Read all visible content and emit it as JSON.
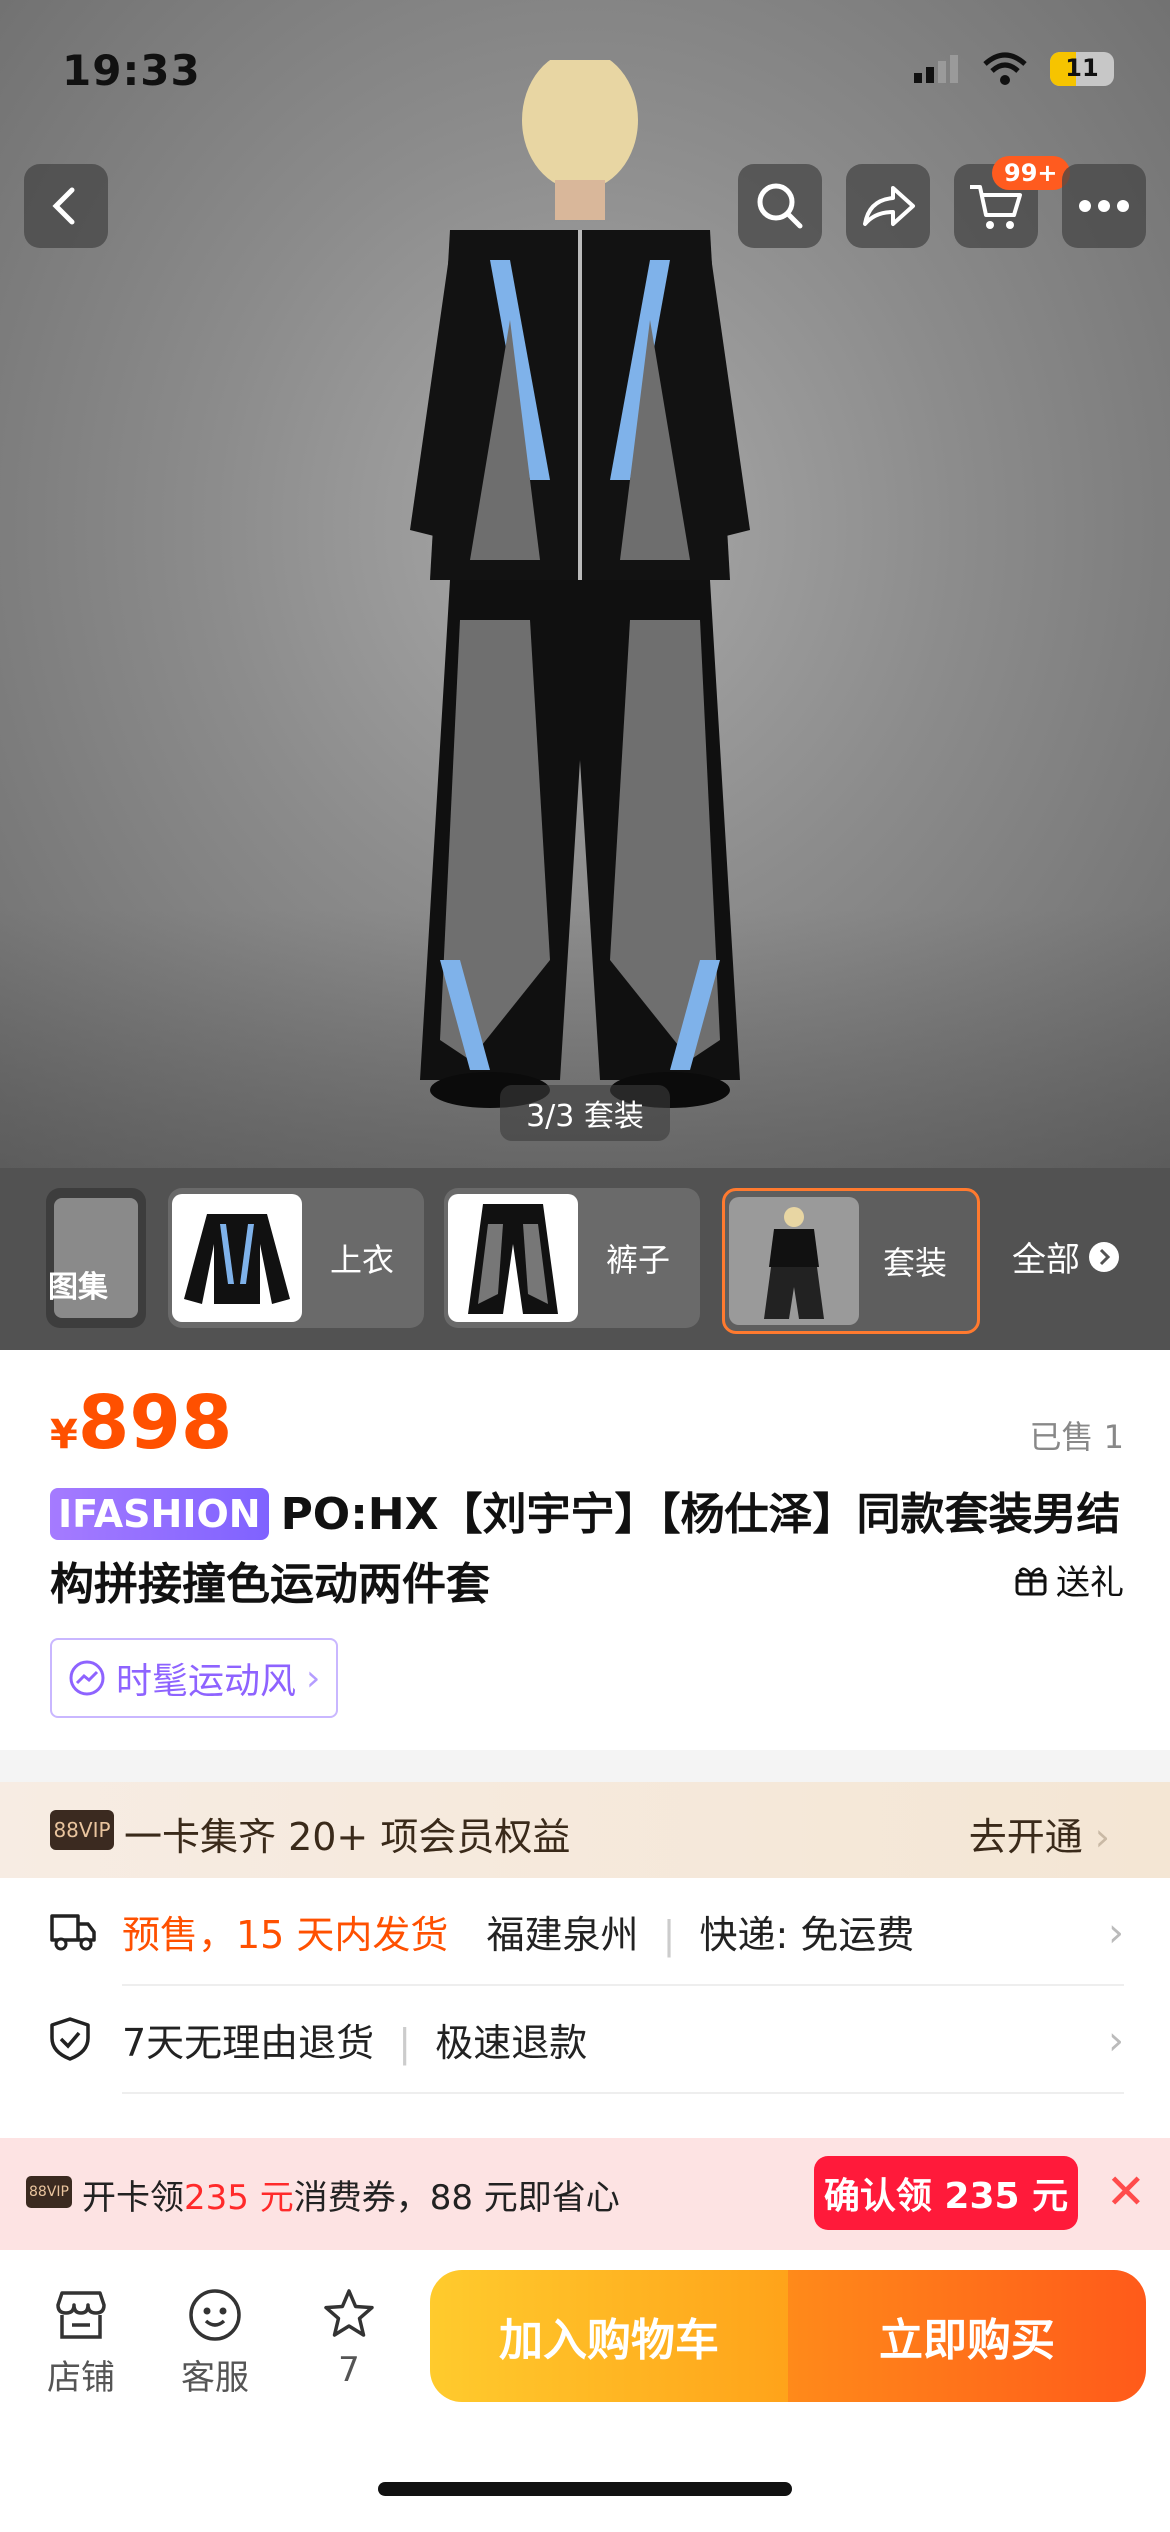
{
  "status_bar": {
    "time": "19:33",
    "battery": "11"
  },
  "top_nav": {
    "cart_badge": "99+"
  },
  "image": {
    "counter": "3/3 套装"
  },
  "thumbnails": [
    {
      "label": "图集"
    },
    {
      "label": "上衣"
    },
    {
      "label": "裤子"
    },
    {
      "label": "套装",
      "selected": true
    }
  ],
  "thumbnails_all": "全部",
  "product": {
    "currency": "¥",
    "price": "898",
    "sold": "已售 1",
    "brand_tag": "IFASHION",
    "title": "PO:HX【刘宇宁】【杨仕泽】同款套装男结构拼接撞色运动两件套",
    "gift": "送礼",
    "style_tag": "时髦运动风"
  },
  "vip": {
    "badge": "88VIP",
    "text": "一卡集齐 20+ 项会员权益",
    "action": "去开通"
  },
  "services": {
    "shipping_presale": "预售，15 天内发货",
    "shipping_origin": "福建泉州",
    "shipping_express": "快递: 免运费",
    "returns": "7天无理由退货",
    "refund": "极速退款"
  },
  "coupon": {
    "badge": "88VIP",
    "text_pre": "开卡领",
    "amount": "235 元",
    "text_post": "消费券，88 元即省心",
    "button": "确认领 235 元"
  },
  "bottom_bar": {
    "store": "店铺",
    "service": "客服",
    "favorites": "7",
    "add_to_cart": "加入购物车",
    "buy_now": "立即购买"
  }
}
